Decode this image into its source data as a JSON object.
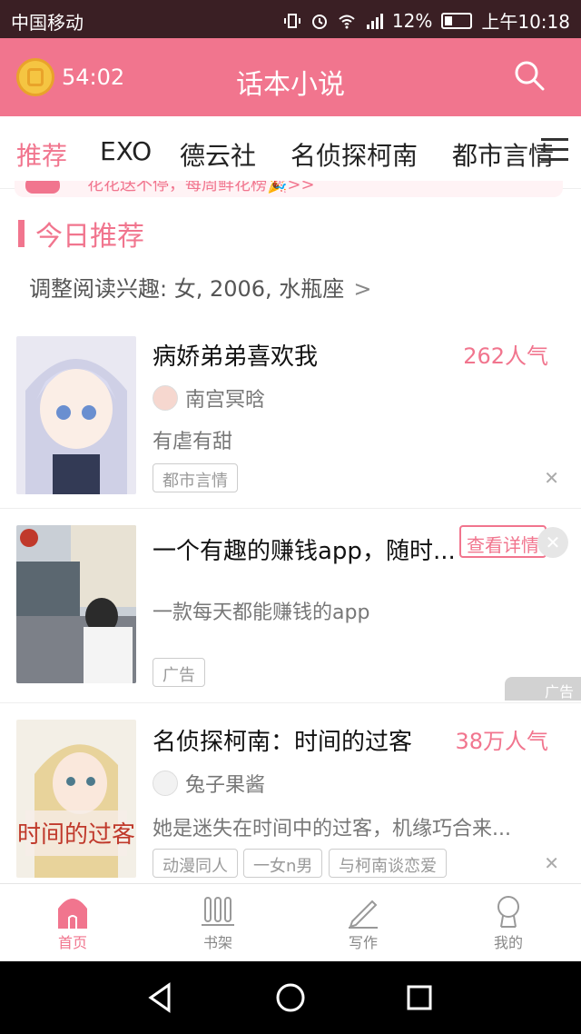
{
  "status": {
    "carrier": "中国移动",
    "signal_label": "26",
    "battery": "12%",
    "time": "上午10:18"
  },
  "header": {
    "timer": "54:02",
    "title": "话本小说"
  },
  "tabs": [
    "推荐",
    "EXO",
    "德云社",
    "名侦探柯南",
    "都市言情"
  ],
  "banner": {
    "text": "花花送不停，每周鲜花榜🎉>>"
  },
  "section": {
    "title": "今日推荐"
  },
  "interest": {
    "text": "调整阅读兴趣: 女, 2006, 水瓶座"
  },
  "cards": [
    {
      "title": "病娇弟弟喜欢我",
      "popularity": "262人气",
      "author": "南宫冥晗",
      "desc": "有虐有甜",
      "tags": [
        "都市言情"
      ]
    },
    {
      "title": "一个有趣的赚钱app，随时...",
      "button": "查看详情",
      "desc": "一款每天都能赚钱的app",
      "tags": [
        "广告"
      ],
      "badge": "广告"
    },
    {
      "title": "名侦探柯南：时间的过客",
      "popularity": "38万人气",
      "author": "兔子果酱",
      "desc": "她是迷失在时间中的过客，机缘巧合来...",
      "tags": [
        "动漫同人",
        "一女n男",
        "与柯南谈恋爱"
      ]
    }
  ],
  "nav": [
    {
      "label": "首页",
      "icon": "home-icon"
    },
    {
      "label": "书架",
      "icon": "bookshelf-icon"
    },
    {
      "label": "写作",
      "icon": "pencil-icon"
    },
    {
      "label": "我的",
      "icon": "profile-icon"
    }
  ],
  "colors": {
    "accent": "#f1758e",
    "status_bar": "#3a1f24"
  }
}
